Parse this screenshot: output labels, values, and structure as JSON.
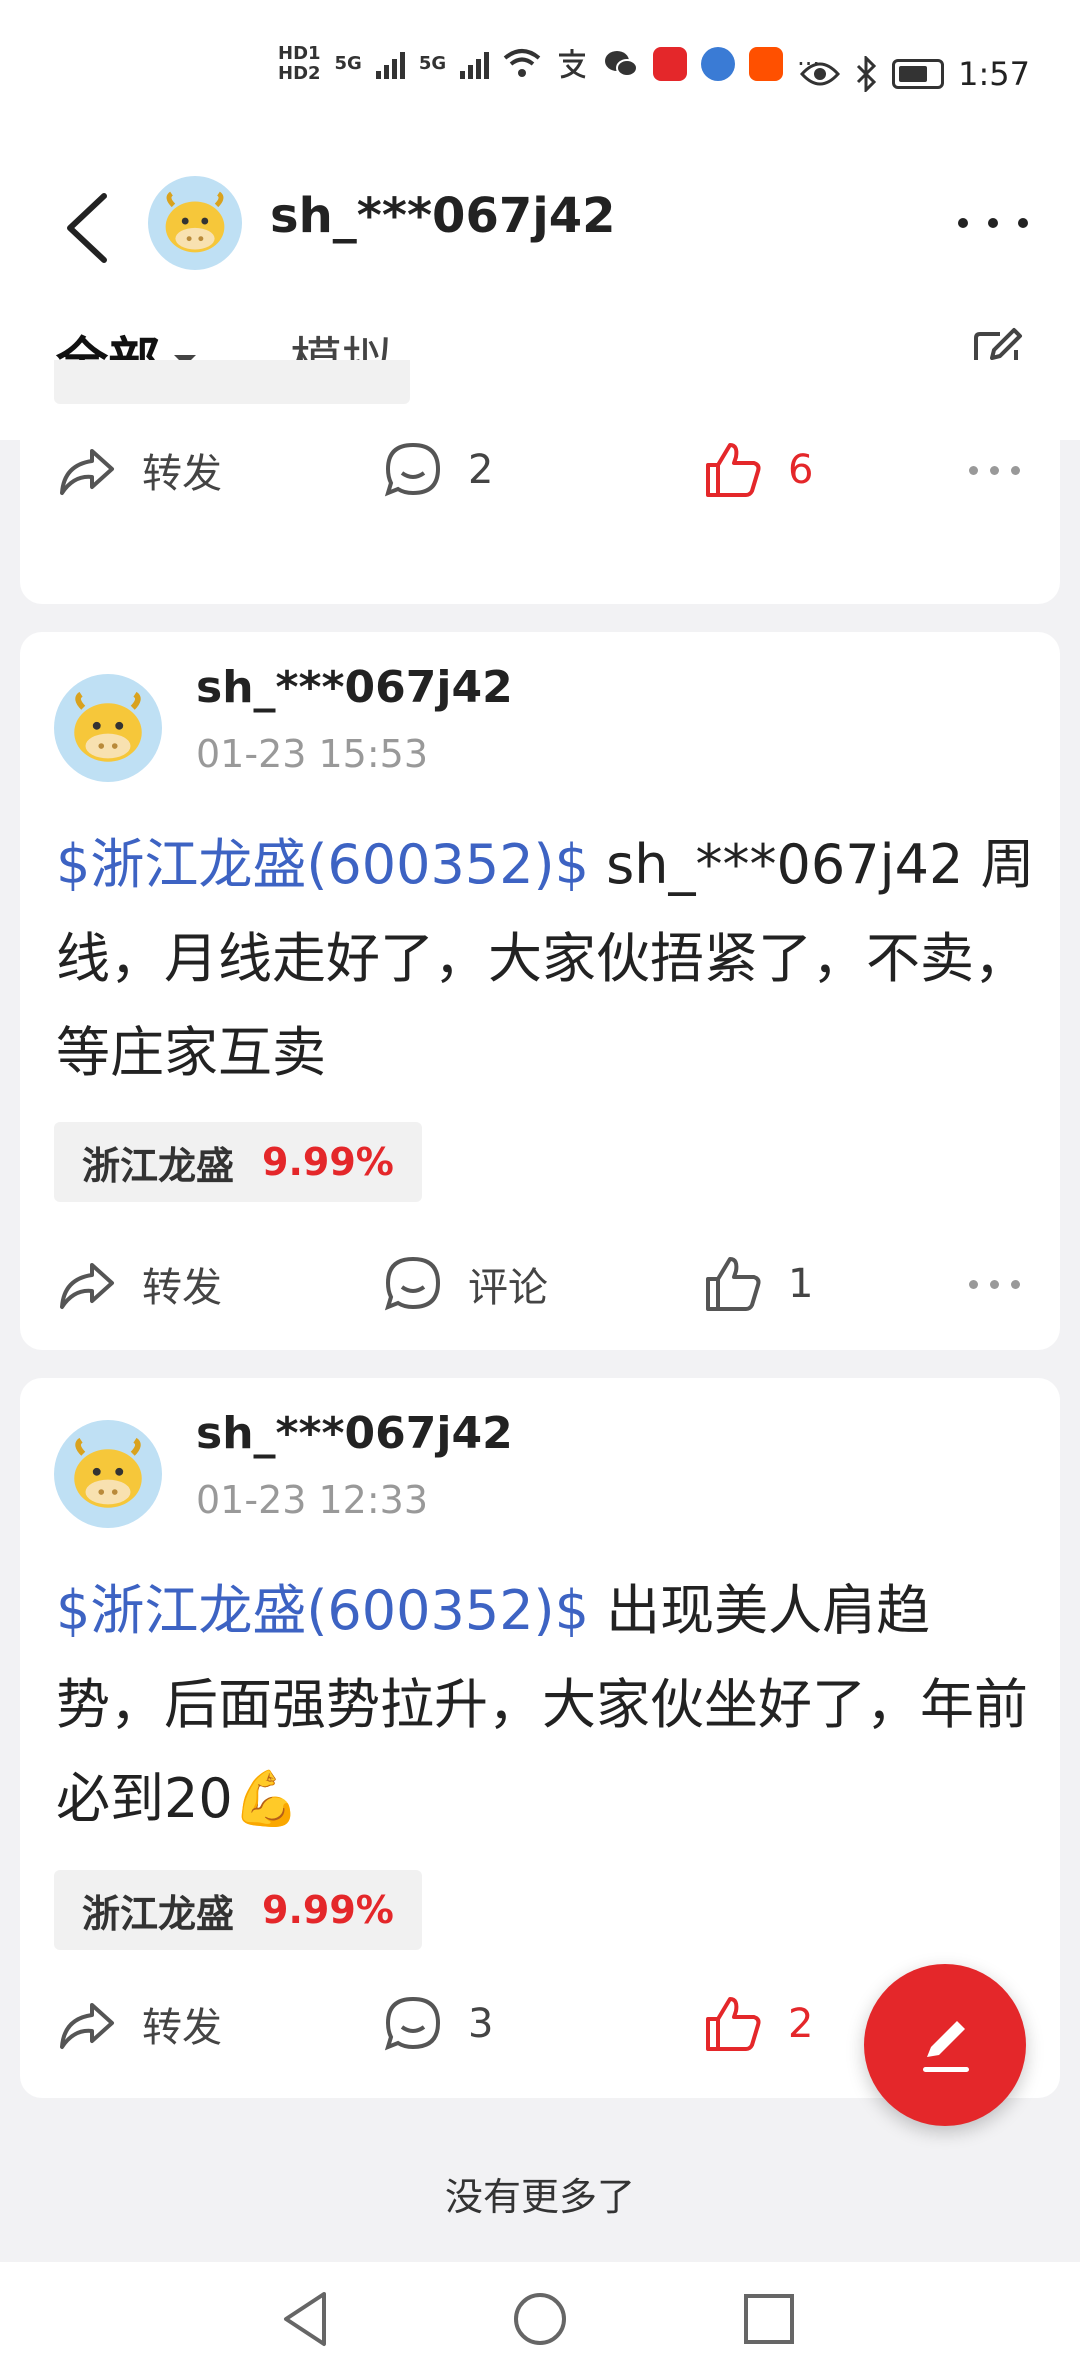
{
  "status_bar": {
    "time": "1:57",
    "hd1": "HD1",
    "hd2": "HD2",
    "net1": "5G",
    "net2": "5G",
    "more": "···"
  },
  "header": {
    "title": "sh_***067j42"
  },
  "tabs": [
    {
      "label": "全部"
    },
    {
      "label": "模拟"
    }
  ],
  "top_card": {
    "share_label": "转发",
    "comment_count": "2",
    "like_count": "6"
  },
  "posts": [
    {
      "author": "sh_***067j42",
      "time": "01-23 15:53",
      "stock_link": "$浙江龙盛(600352)$",
      "body": " sh_***067j42 周线，月线走好了，大家伙捂紧了，不卖，等庄家互卖",
      "tag_name": "浙江龙盛",
      "tag_pct": "9.99%",
      "share_label": "转发",
      "comment_label": "评论",
      "like_count": "1"
    },
    {
      "author": "sh_***067j42",
      "time": "01-23 12:33",
      "stock_link": "$浙江龙盛(600352)$",
      "body": " 出现美人肩趋势，后面强势拉升，大家伙坐好了，年前必到20",
      "emoji": "💪",
      "tag_name": "浙江龙盛",
      "tag_pct": "9.99%",
      "share_label": "转发",
      "comment_count": "3",
      "like_count": "2"
    }
  ],
  "footer": {
    "no_more": "没有更多了"
  },
  "colors": {
    "accent": "#e4272a",
    "link": "#3d63c3"
  }
}
